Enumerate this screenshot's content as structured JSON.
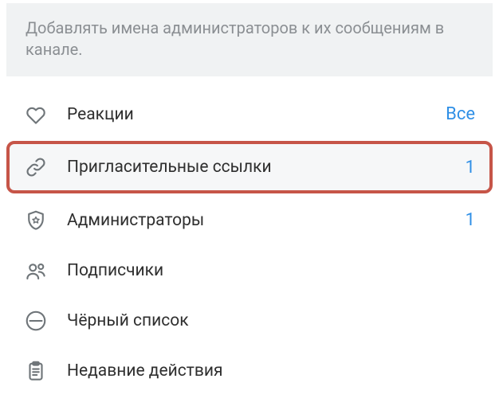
{
  "info": {
    "text": "Добавлять имена администраторов к их сообщениям в канале."
  },
  "settings": {
    "reactions": {
      "label": "Реакции",
      "value": "Все"
    },
    "invite_links": {
      "label": "Пригласительные ссылки",
      "value": "1"
    },
    "admins": {
      "label": "Администраторы",
      "value": "1"
    },
    "subscribers": {
      "label": "Подписчики",
      "value": ""
    },
    "blacklist": {
      "label": "Чёрный список",
      "value": ""
    },
    "recent_actions": {
      "label": "Недавние действия",
      "value": ""
    }
  },
  "colors": {
    "accent": "#2f8fe6",
    "highlight_border": "#c65548",
    "muted_text": "#8b8f93",
    "info_bg": "#f0f2f3"
  }
}
